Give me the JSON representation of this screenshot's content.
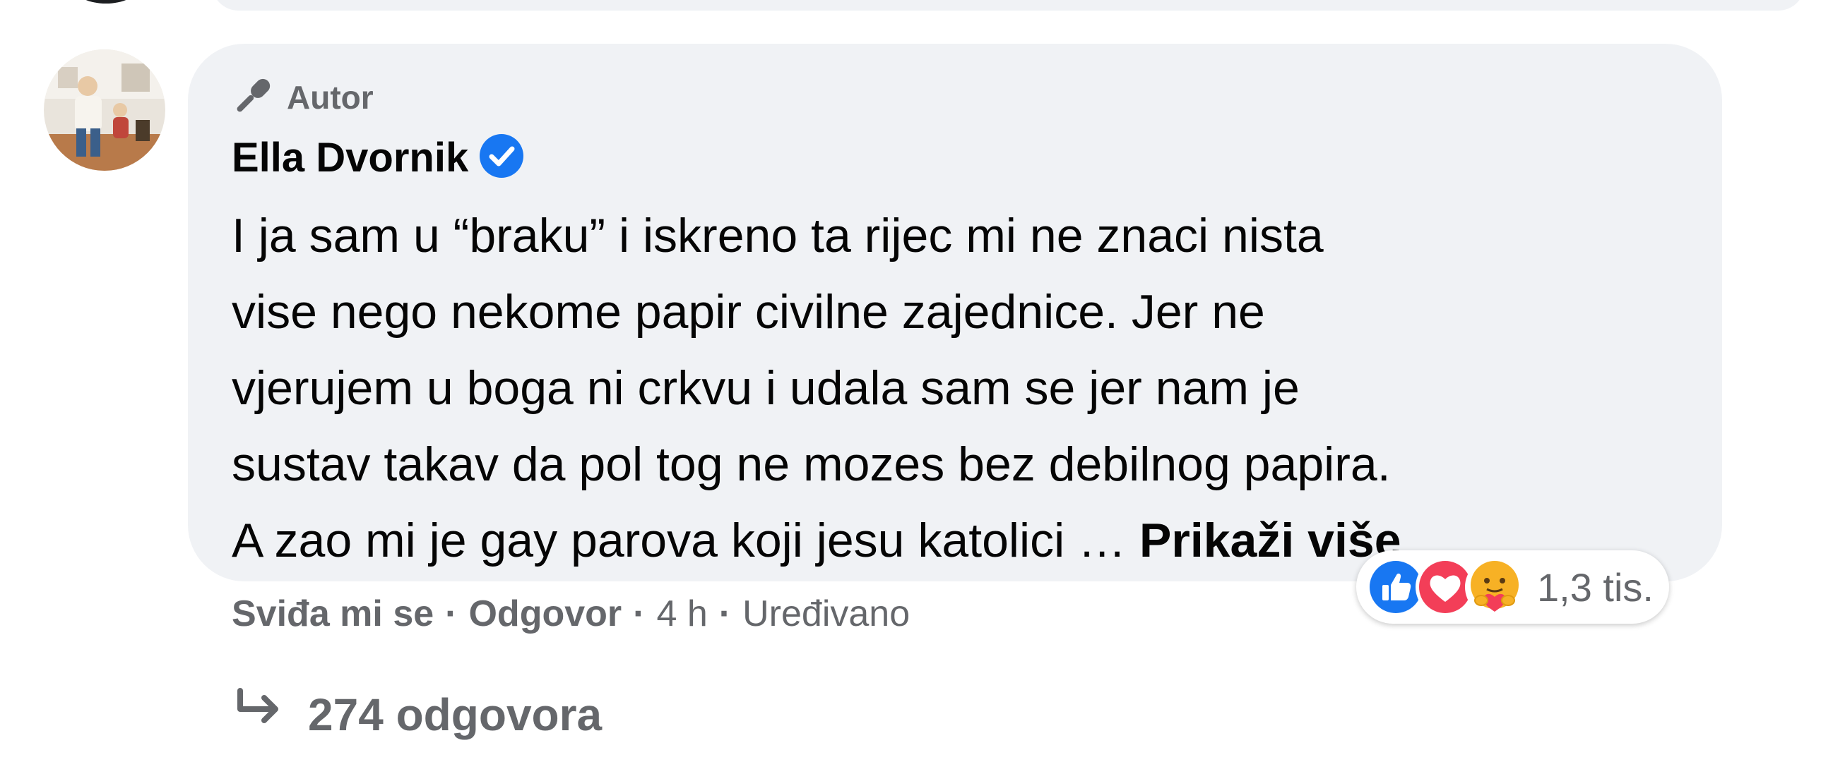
{
  "comment": {
    "author_badge": "Autor",
    "author_name": "Ella Dvornik",
    "text_lines": [
      "I ja sam u “braku” i iskreno ta rijec mi ne znaci nista",
      "vise nego nekome papir civilne zajednice. Jer ne",
      "vjerujem u boga ni crkvu i udala sam se jer nam je",
      "sustav takav da pol tog ne mozes bez debilnog papira.",
      "A zao mi je gay parova koji jesu katolici … "
    ],
    "see_more_label": "Prikaži više",
    "reactions": {
      "icons": [
        "like-icon",
        "love-icon",
        "care-icon"
      ],
      "count": "1,3 tis."
    },
    "actions": {
      "like_label": "Sviđa mi se",
      "reply_label": "Odgovor",
      "time": "4 h",
      "edited": "Uređivano",
      "separator": "·"
    },
    "replies_label": "274 odgovora"
  },
  "colors": {
    "bubble": "#f0f2f5",
    "text": "#050505",
    "secondary": "#65676b",
    "verified": "#1877f2",
    "like": "#1877f2",
    "love": "#f33e58",
    "care": "#f7b125"
  }
}
